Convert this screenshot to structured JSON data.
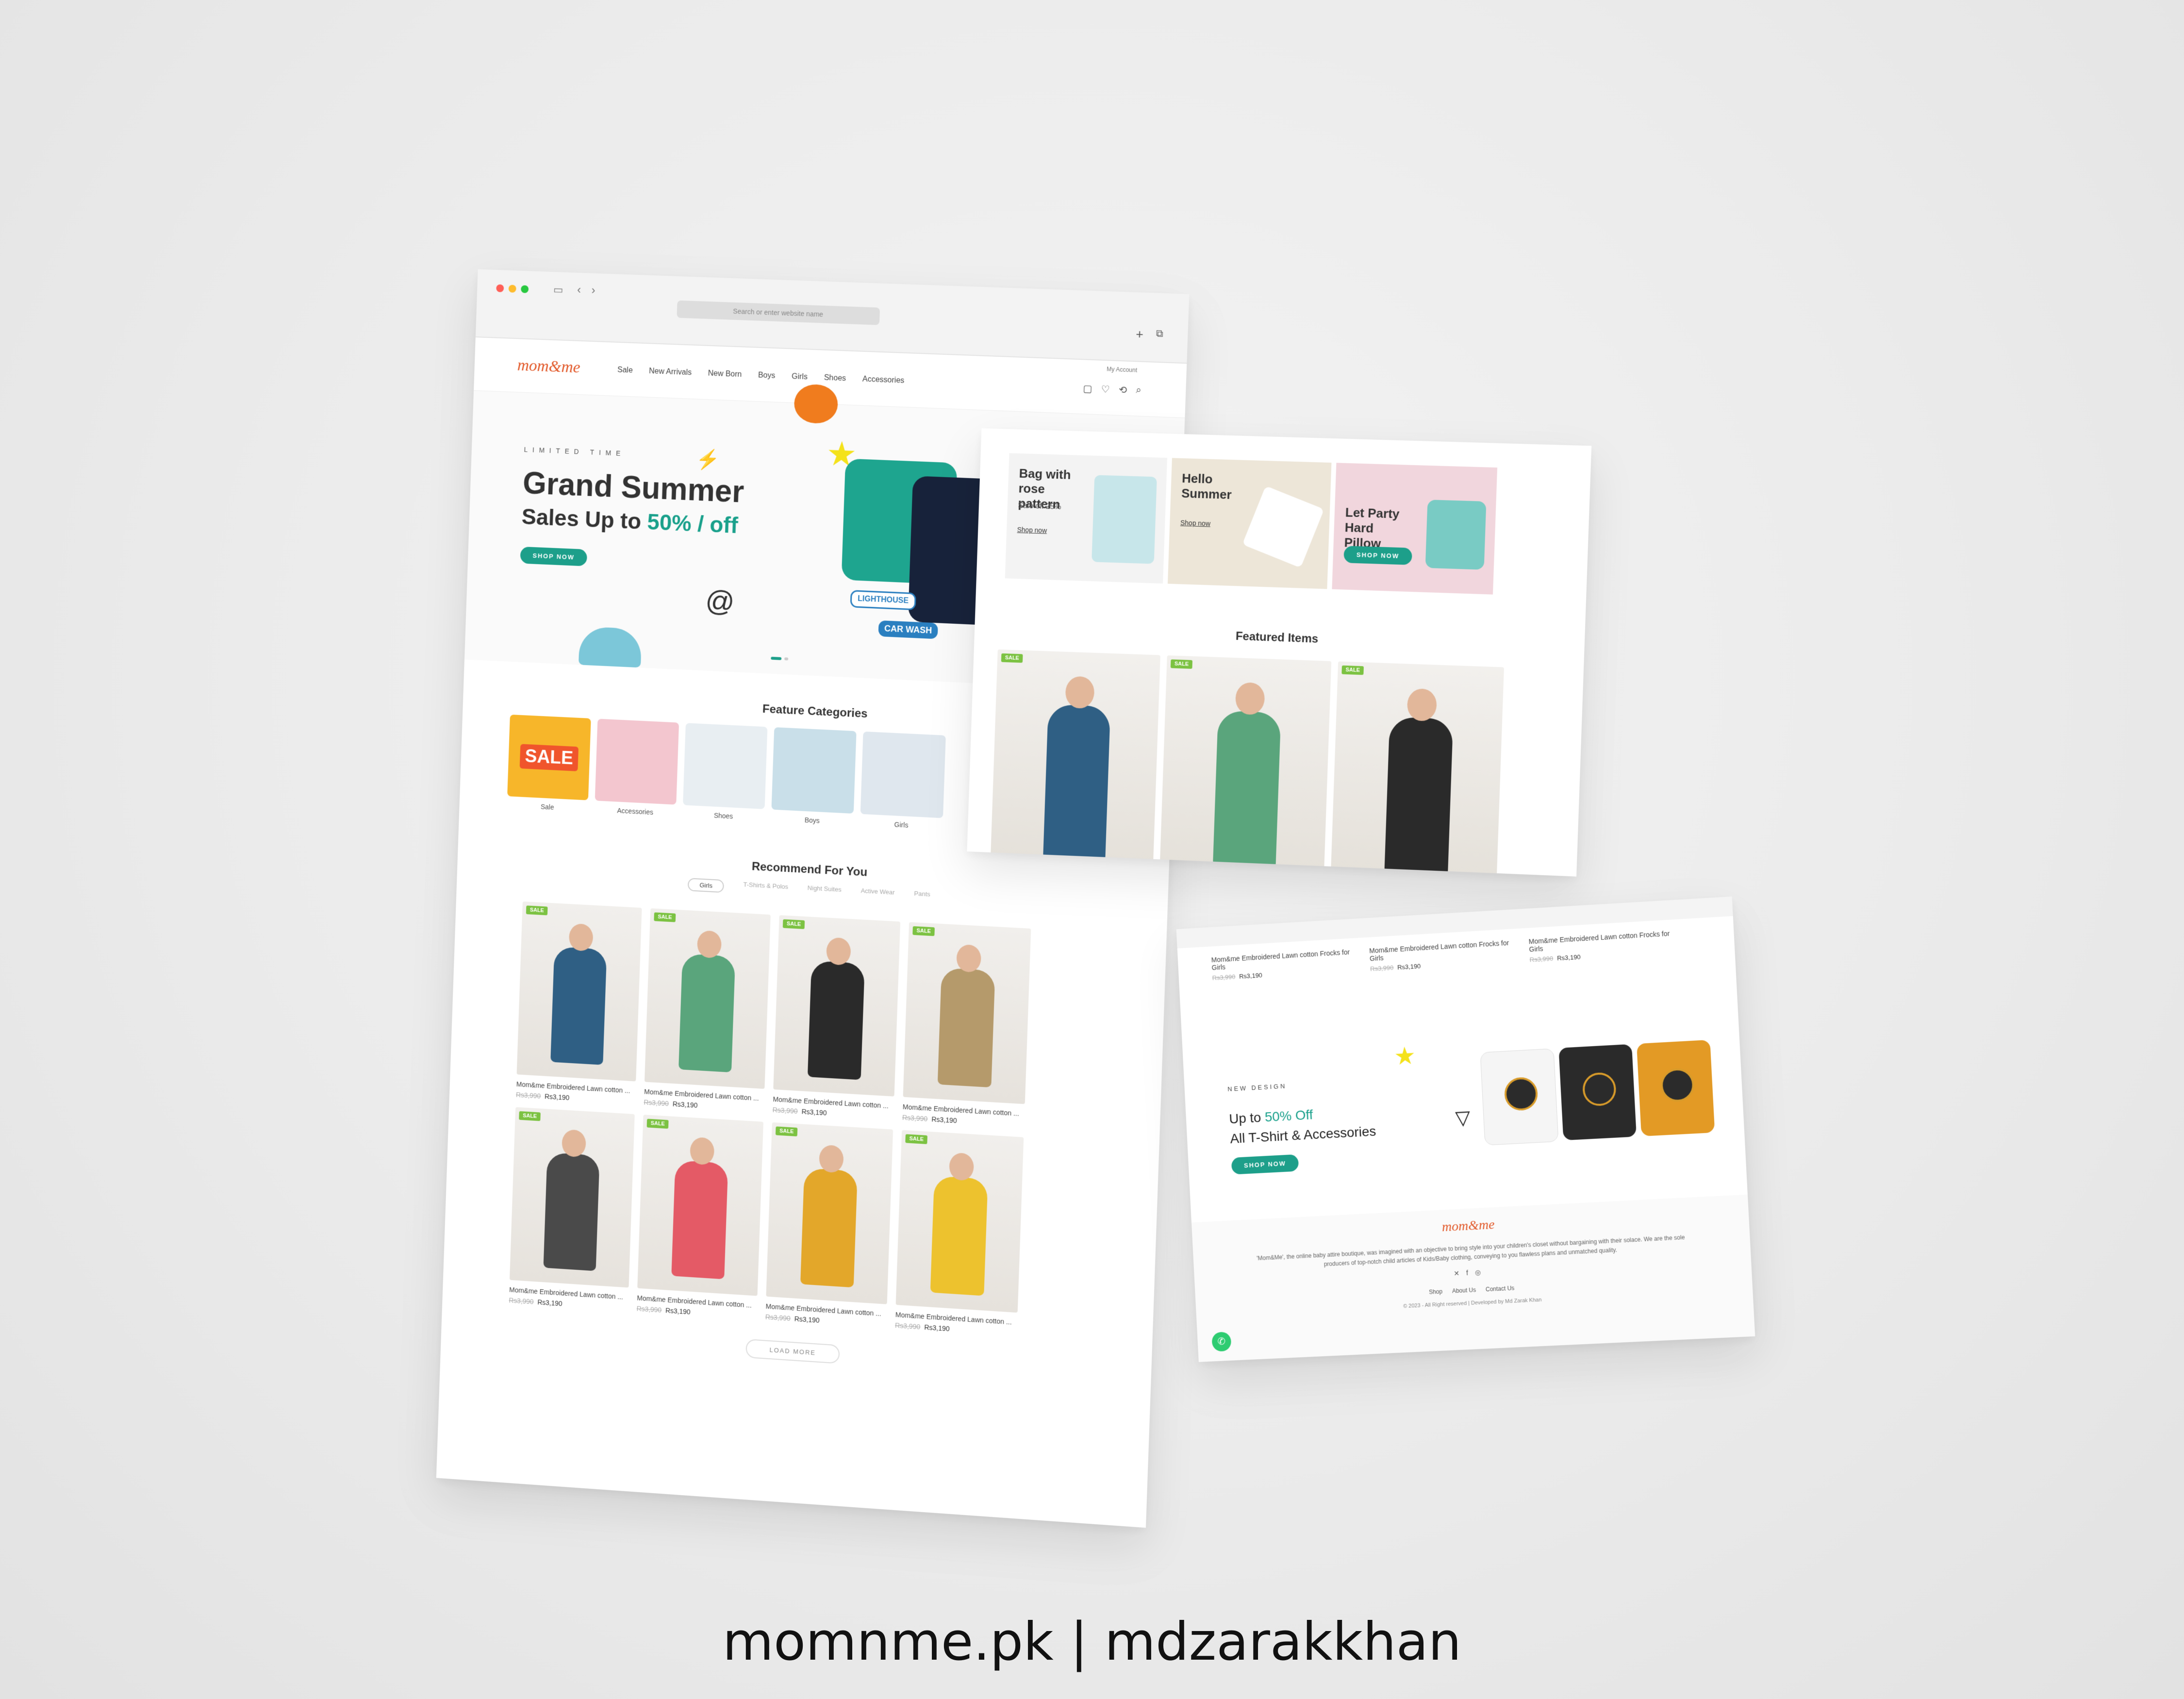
{
  "browser": {
    "url_placeholder": "Search or enter website name"
  },
  "header": {
    "logo_text": "mom&me",
    "account_label": "My Account",
    "nav": [
      "Sale",
      "New Arrivals",
      "New Born",
      "Boys",
      "Girls",
      "Shoes",
      "Accessories"
    ]
  },
  "hero": {
    "eyebrow": "LIMITED TIME",
    "title": "Grand Summer",
    "subtitle_prefix": "Sales Up to ",
    "subtitle_accent": "50% / off",
    "button": "SHOP NOW",
    "badge_1": "LIGHTHOUSE",
    "badge_2": "CAR WASH"
  },
  "categories": {
    "title": "Feature Categories",
    "sale_banner": "SALE",
    "items": [
      "Sale",
      "Accessories",
      "Shoes",
      "Boys",
      "Girls"
    ]
  },
  "recommend": {
    "title": "Recommend For You",
    "tabs": [
      "Girls",
      "T-Shirts & Polos",
      "Night Suites",
      "Active Wear",
      "Pants"
    ],
    "sale_tag": "SALE",
    "products": [
      {
        "name": "Mom&me Embroidered Lawn cotton ...",
        "old_price": "Rs3,990",
        "price": "Rs3,190",
        "color": "#2f5f84"
      },
      {
        "name": "Mom&me Embroidered Lawn cotton ...",
        "old_price": "Rs3,990",
        "price": "Rs3,190",
        "color": "#5aa57c"
      },
      {
        "name": "Mom&me Embroidered Lawn cotton ...",
        "old_price": "Rs3,990",
        "price": "Rs3,190",
        "color": "#2a2a2a"
      },
      {
        "name": "Mom&me Embroidered Lawn cotton ...",
        "old_price": "Rs3,990",
        "price": "Rs3,190",
        "color": "#b59a6b"
      },
      {
        "name": "Mom&me Embroidered Lawn cotton ...",
        "old_price": "Rs3,990",
        "price": "Rs3,190",
        "color": "#4a4a4a"
      },
      {
        "name": "Mom&me Embroidered Lawn cotton ...",
        "old_price": "Rs3,990",
        "price": "Rs3,190",
        "color": "#e45a66"
      },
      {
        "name": "Mom&me Embroidered Lawn cotton ...",
        "old_price": "Rs3,990",
        "price": "Rs3,190",
        "color": "#e3a72a"
      },
      {
        "name": "Mom&me Embroidered Lawn cotton ...",
        "old_price": "Rs3,990",
        "price": "Rs3,190",
        "color": "#edc22e"
      }
    ],
    "load_more": "LOAD MORE"
  },
  "promos": [
    {
      "title": "Bag with rose pattern",
      "note": "Sale off 25%",
      "link": "Shop now",
      "bg": "#f3f3f3"
    },
    {
      "title": "Hello Summer",
      "link": "Shop now",
      "bg": "#ede6d8"
    },
    {
      "title": "Let Party Hard Pillow",
      "button": "SHOP NOW",
      "bg": "#f1d6dd"
    }
  ],
  "featured": {
    "title": "Featured Items",
    "sale_tag": "SALE",
    "colors": [
      "#2f5f84",
      "#5aa57c",
      "#2a2a2a"
    ]
  },
  "mini_products": [
    {
      "name": "Mom&me Embroidered Lawn cotton Frocks for Girls",
      "old_price": "Rs3,990",
      "price": "Rs3,190"
    },
    {
      "name": "Mom&me Embroidered Lawn cotton Frocks for Girls",
      "old_price": "Rs3,990",
      "price": "Rs3,190"
    },
    {
      "name": "Mom&me Embroidered Lawn cotton Frocks for Girls",
      "old_price": "Rs3,990",
      "price": "Rs3,190"
    }
  ],
  "new_design": {
    "eyebrow": "NEW DESIGN",
    "line1_prefix": "Up to ",
    "line1_accent": "50% Off",
    "line2": "All T-Shirt & Accessories",
    "button": "SHOP NOW"
  },
  "footer": {
    "logo_text": "mom&me",
    "description": "'Mom&Me', the online baby attire boutique, was imagined with an objective to bring style into your children's closet without bargaining with their solace. We are the sole producers of top-notch child articles of Kids/Baby clothing, conveying to you flawless plans and unmatched quality.",
    "links": [
      "Shop",
      "About Us",
      "Contact Us"
    ],
    "copyright": "© 2023 - All Right reserved | Developed by Md Zarak Khan"
  },
  "caption": "momnme.pk | mdzarakkhan",
  "colors": {
    "accent": "#19a08b",
    "brand": "#e25a2b",
    "sale": "#7cc242"
  }
}
